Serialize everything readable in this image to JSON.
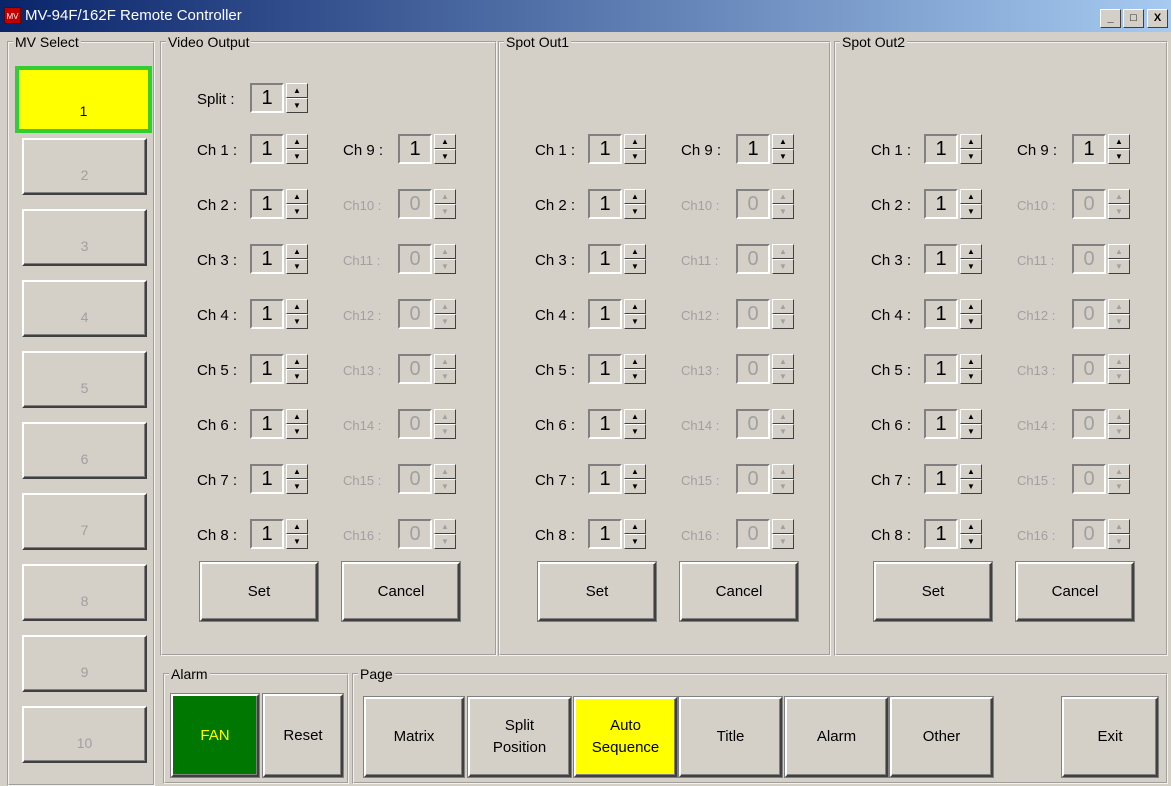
{
  "window": {
    "title": "MV-94F/162F Remote Controller",
    "icon": "app-icon",
    "minimize": "_",
    "maximize": "□",
    "close": "X"
  },
  "mv_select": {
    "legend": "MV Select",
    "buttons": [
      "1",
      "2",
      "3",
      "4",
      "5",
      "6",
      "7",
      "8",
      "9",
      "10"
    ],
    "active": "1"
  },
  "panels": [
    {
      "legend": "Video Output",
      "split_label": "Split :",
      "split_value": "1",
      "left": [
        {
          "label": "Ch 1 :",
          "value": "1"
        },
        {
          "label": "Ch 2 :",
          "value": "1"
        },
        {
          "label": "Ch 3 :",
          "value": "1"
        },
        {
          "label": "Ch 4 :",
          "value": "1"
        },
        {
          "label": "Ch 5 :",
          "value": "1"
        },
        {
          "label": "Ch 6 :",
          "value": "1"
        },
        {
          "label": "Ch 7 :",
          "value": "1"
        },
        {
          "label": "Ch 8 :",
          "value": "1"
        }
      ],
      "right": [
        {
          "label": "Ch 9 :",
          "value": "1",
          "enabled": true
        },
        {
          "label": "Ch10 :",
          "value": "0",
          "enabled": false
        },
        {
          "label": "Ch11 :",
          "value": "0",
          "enabled": false
        },
        {
          "label": "Ch12 :",
          "value": "0",
          "enabled": false
        },
        {
          "label": "Ch13 :",
          "value": "0",
          "enabled": false
        },
        {
          "label": "Ch14 :",
          "value": "0",
          "enabled": false
        },
        {
          "label": "Ch15 :",
          "value": "0",
          "enabled": false
        },
        {
          "label": "Ch16 :",
          "value": "0",
          "enabled": false
        }
      ],
      "set_label": "Set",
      "cancel_label": "Cancel"
    },
    {
      "legend": "Spot Out1",
      "left": [
        {
          "label": "Ch 1 :",
          "value": "1"
        },
        {
          "label": "Ch 2 :",
          "value": "1"
        },
        {
          "label": "Ch 3 :",
          "value": "1"
        },
        {
          "label": "Ch 4 :",
          "value": "1"
        },
        {
          "label": "Ch 5 :",
          "value": "1"
        },
        {
          "label": "Ch 6 :",
          "value": "1"
        },
        {
          "label": "Ch 7 :",
          "value": "1"
        },
        {
          "label": "Ch 8 :",
          "value": "1"
        }
      ],
      "right": [
        {
          "label": "Ch 9 :",
          "value": "1",
          "enabled": true
        },
        {
          "label": "Ch10 :",
          "value": "0",
          "enabled": false
        },
        {
          "label": "Ch11 :",
          "value": "0",
          "enabled": false
        },
        {
          "label": "Ch12 :",
          "value": "0",
          "enabled": false
        },
        {
          "label": "Ch13 :",
          "value": "0",
          "enabled": false
        },
        {
          "label": "Ch14 :",
          "value": "0",
          "enabled": false
        },
        {
          "label": "Ch15 :",
          "value": "0",
          "enabled": false
        },
        {
          "label": "Ch16 :",
          "value": "0",
          "enabled": false
        }
      ],
      "set_label": "Set",
      "cancel_label": "Cancel"
    },
    {
      "legend": "Spot Out2",
      "left": [
        {
          "label": "Ch 1 :",
          "value": "1"
        },
        {
          "label": "Ch 2 :",
          "value": "1"
        },
        {
          "label": "Ch 3 :",
          "value": "1"
        },
        {
          "label": "Ch 4 :",
          "value": "1"
        },
        {
          "label": "Ch 5 :",
          "value": "1"
        },
        {
          "label": "Ch 6 :",
          "value": "1"
        },
        {
          "label": "Ch 7 :",
          "value": "1"
        },
        {
          "label": "Ch 8 :",
          "value": "1"
        }
      ],
      "right": [
        {
          "label": "Ch 9 :",
          "value": "1",
          "enabled": true
        },
        {
          "label": "Ch10 :",
          "value": "0",
          "enabled": false
        },
        {
          "label": "Ch11 :",
          "value": "0",
          "enabled": false
        },
        {
          "label": "Ch12 :",
          "value": "0",
          "enabled": false
        },
        {
          "label": "Ch13 :",
          "value": "0",
          "enabled": false
        },
        {
          "label": "Ch14 :",
          "value": "0",
          "enabled": false
        },
        {
          "label": "Ch15 :",
          "value": "0",
          "enabled": false
        },
        {
          "label": "Ch16 :",
          "value": "0",
          "enabled": false
        }
      ],
      "set_label": "Set",
      "cancel_label": "Cancel"
    }
  ],
  "alarm": {
    "legend": "Alarm",
    "fan_label": "FAN",
    "reset_label": "Reset"
  },
  "page": {
    "legend": "Page",
    "buttons": [
      {
        "label": "Matrix",
        "active": false
      },
      {
        "label": "Split\nPosition",
        "active": false
      },
      {
        "label": "Auto\nSequence",
        "active": true
      },
      {
        "label": "Title",
        "active": false
      },
      {
        "label": "Alarm",
        "active": false
      },
      {
        "label": "Other",
        "active": false
      }
    ],
    "exit_label": "Exit"
  },
  "colors": {
    "active_yellow": "#ffff00",
    "active_border_green": "#33cc33",
    "fan_green": "#007700",
    "face": "#d4d0c8",
    "title_start": "#0a246a",
    "title_end": "#a6caf0"
  }
}
